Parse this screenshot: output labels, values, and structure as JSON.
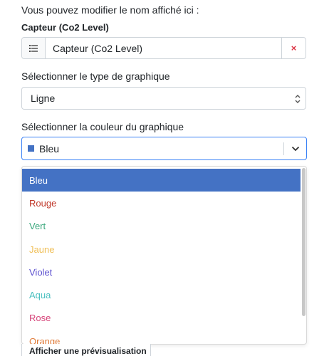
{
  "hint": "Vous pouvez modifier le nom affiché ici :",
  "field_title": "Capteur (Co2 Level)",
  "name_input": {
    "value": "Capteur (Co2 Level)",
    "clear_icon": "×"
  },
  "chart_type": {
    "label": "Sélectionner le type de graphique",
    "selected": "Ligne"
  },
  "chart_color": {
    "label": "Sélectionner la couleur du graphique",
    "selected": "Bleu",
    "selected_color": "#4472c4",
    "options": [
      {
        "label": "Bleu",
        "color": "#ffffff"
      },
      {
        "label": "Rouge",
        "color": "#c0392b"
      },
      {
        "label": "Vert",
        "color": "#3aa77c"
      },
      {
        "label": "Jaune",
        "color": "#f0c05a"
      },
      {
        "label": "Violet",
        "color": "#5b4fcf"
      },
      {
        "label": "Aqua",
        "color": "#4bc0c0"
      },
      {
        "label": "Rose",
        "color": "#d6457a"
      },
      {
        "label": "Orange",
        "color": "#e07b39"
      }
    ]
  },
  "preview_button": "Afficher une prévisualisation"
}
